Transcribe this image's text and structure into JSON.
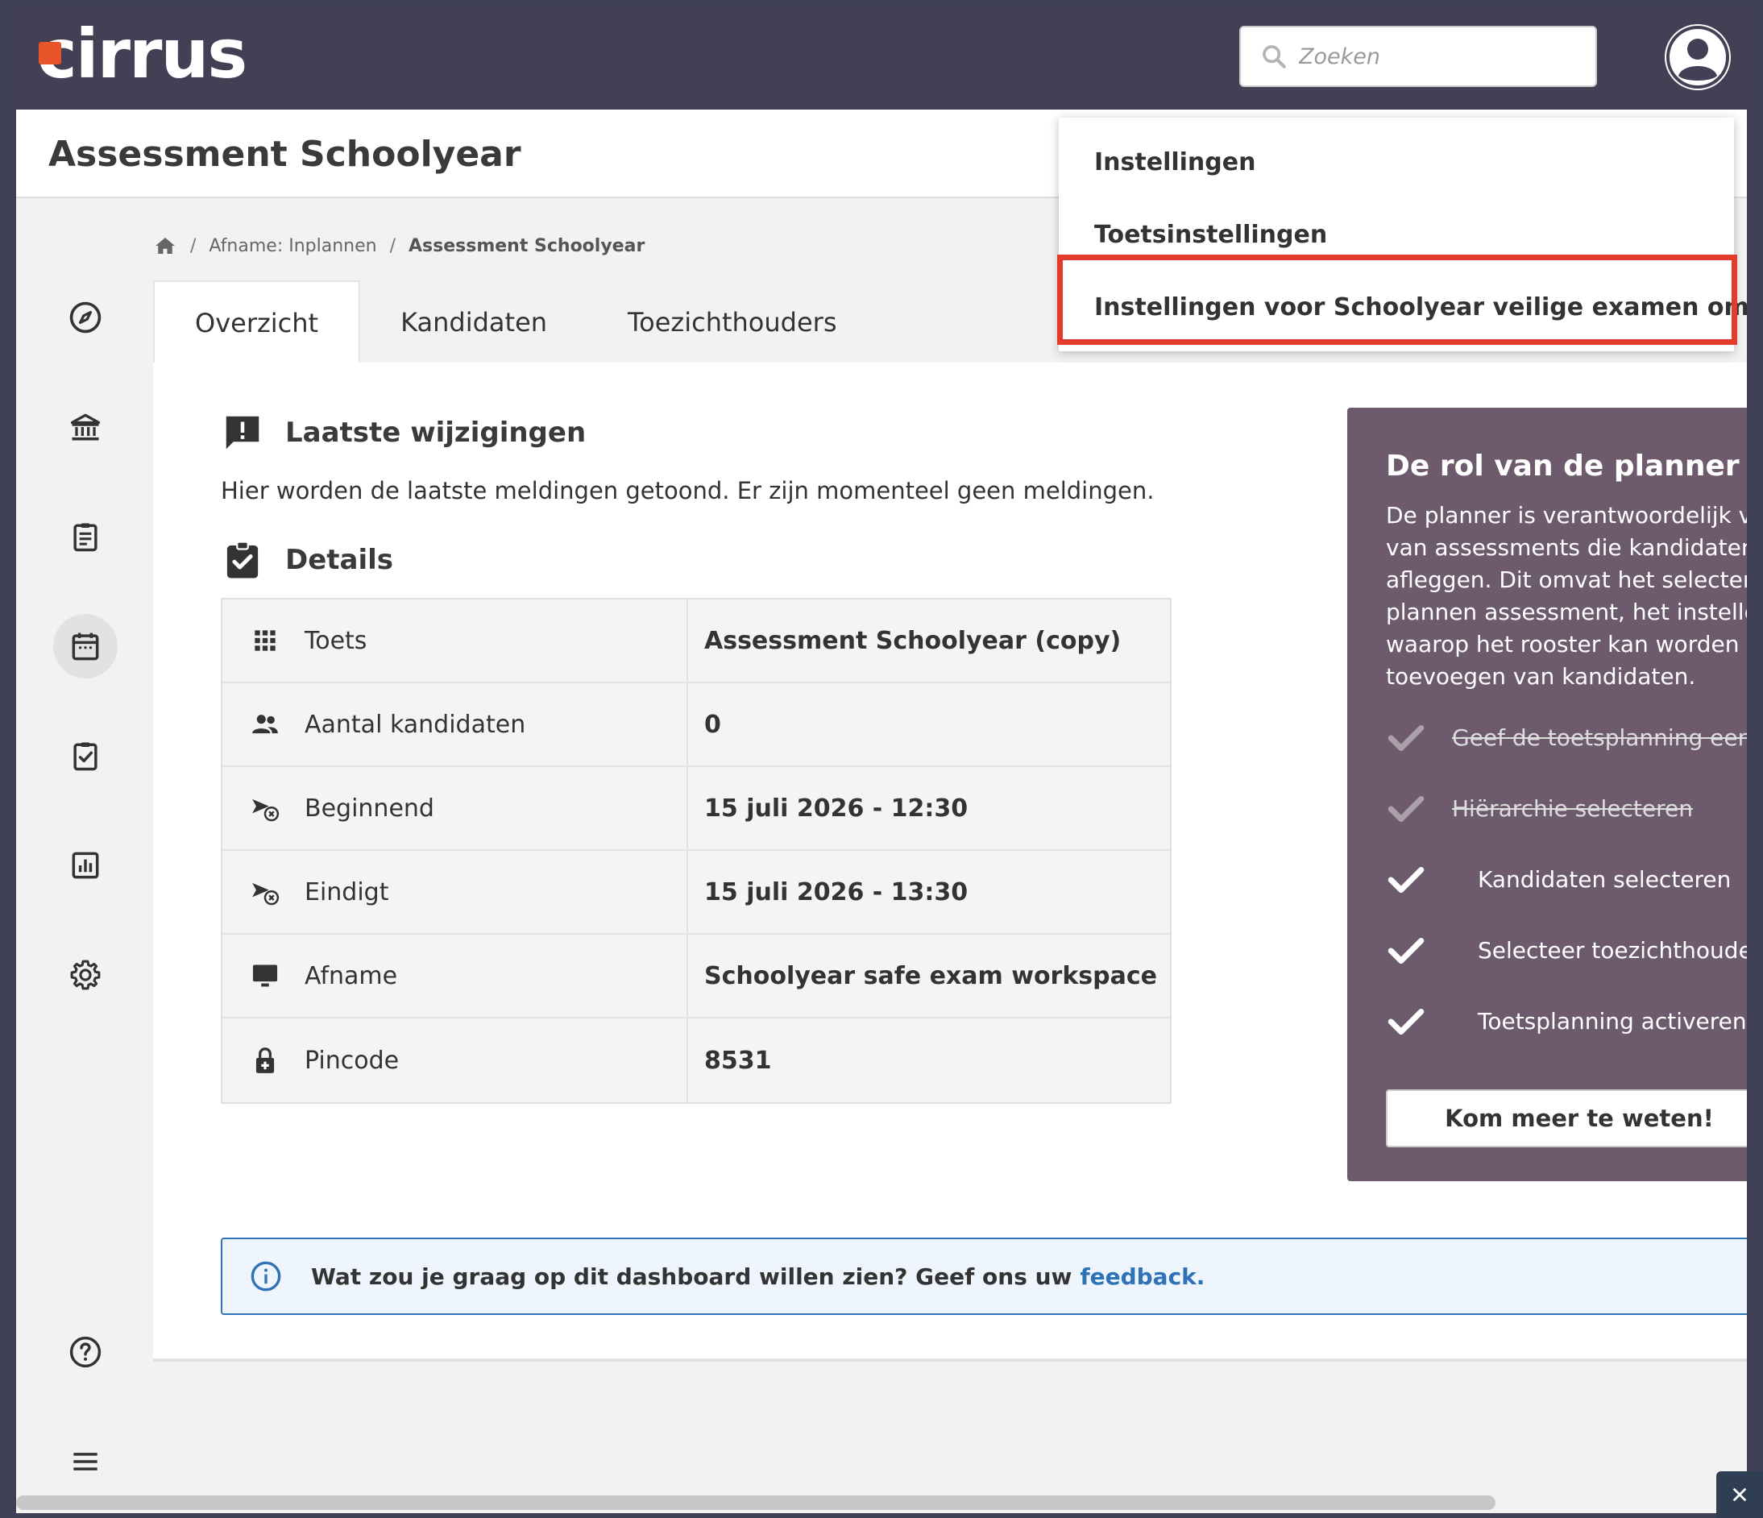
{
  "app": {
    "logo_text": "cirrus",
    "accent_color": "#e8552b",
    "topbar_color": "#443f55"
  },
  "search": {
    "placeholder": "Zoeken"
  },
  "page": {
    "title": "Assessment Schoolyear"
  },
  "breadcrumb": {
    "level1": "Afname: Inplannen",
    "separator": "/",
    "current": "Assessment Schoolyear"
  },
  "tabs": [
    {
      "label": "Overzicht",
      "active": true
    },
    {
      "label": "Kandidaten",
      "active": false
    },
    {
      "label": "Toezichthouders",
      "active": false
    }
  ],
  "notifications": {
    "title": "Laatste wijzigingen",
    "text": "Hier worden de laatste meldingen getoond. Er zijn momenteel geen meldingen."
  },
  "details": {
    "title": "Details",
    "rows": [
      {
        "icon": "grid-icon",
        "label": "Toets",
        "value": "Assessment Schoolyear (copy)"
      },
      {
        "icon": "people-icon",
        "label": "Aantal kandidaten",
        "value": "0"
      },
      {
        "icon": "flight-takeoff-cancel-icon",
        "label": "Beginnend",
        "value": "15 juli 2026 - 12:30"
      },
      {
        "icon": "flight-takeoff-cancel-icon",
        "label": "Eindigt",
        "value": "15 juli 2026 - 13:30"
      },
      {
        "icon": "monitor-icon",
        "label": "Afname",
        "value": "Schoolyear safe exam workspace"
      },
      {
        "icon": "lock-plus-icon",
        "label": "Pincode",
        "value": "8531"
      }
    ]
  },
  "info_banner": {
    "text": "Wat zou je graag op dit dashboard willen zien? Geef ons uw",
    "link": "feedback.",
    "link_color": "#2e72b8"
  },
  "planner": {
    "title": "De rol van de planner",
    "description_lines": [
      "De planner is verantwoordelijk voor",
      "van assessments die kandidaten mo",
      "afleggen. Dit omvat het selecteren v",
      "plannen assessment, het instellen v",
      "waarop het rooster kan worden afg",
      "toevoegen van kandidaten."
    ],
    "steps": [
      {
        "label": "Geef de toetsplanning een na",
        "done": true
      },
      {
        "label": "Hiërarchie selecteren",
        "done": true
      },
      {
        "label": "Kandidaten selecteren",
        "done": false
      },
      {
        "label": "Selecteer toezichthouders (",
        "done": false
      },
      {
        "label": "Toetsplanning activeren",
        "done": false
      }
    ],
    "button": "Kom meer te weten!",
    "background_color": "#6d5b6d"
  },
  "dropdown": {
    "items": [
      {
        "label": "Instellingen",
        "highlighted": false
      },
      {
        "label": "Toetsinstellingen",
        "highlighted": false
      },
      {
        "label": "Instellingen voor Schoolyear veilige examen omgeving",
        "highlighted": true
      }
    ],
    "highlight_color": "#e43b2c"
  },
  "sidebar": {
    "items": [
      {
        "icon": "compass-icon"
      },
      {
        "icon": "institution-icon"
      },
      {
        "icon": "clipboard-list-icon"
      },
      {
        "icon": "calendar-icon",
        "active": true
      },
      {
        "icon": "clipboard-check-icon"
      },
      {
        "icon": "bar-chart-icon"
      },
      {
        "icon": "gear-icon"
      }
    ],
    "bottom": [
      {
        "icon": "help-icon"
      },
      {
        "icon": "hamburger-menu-icon"
      }
    ]
  }
}
